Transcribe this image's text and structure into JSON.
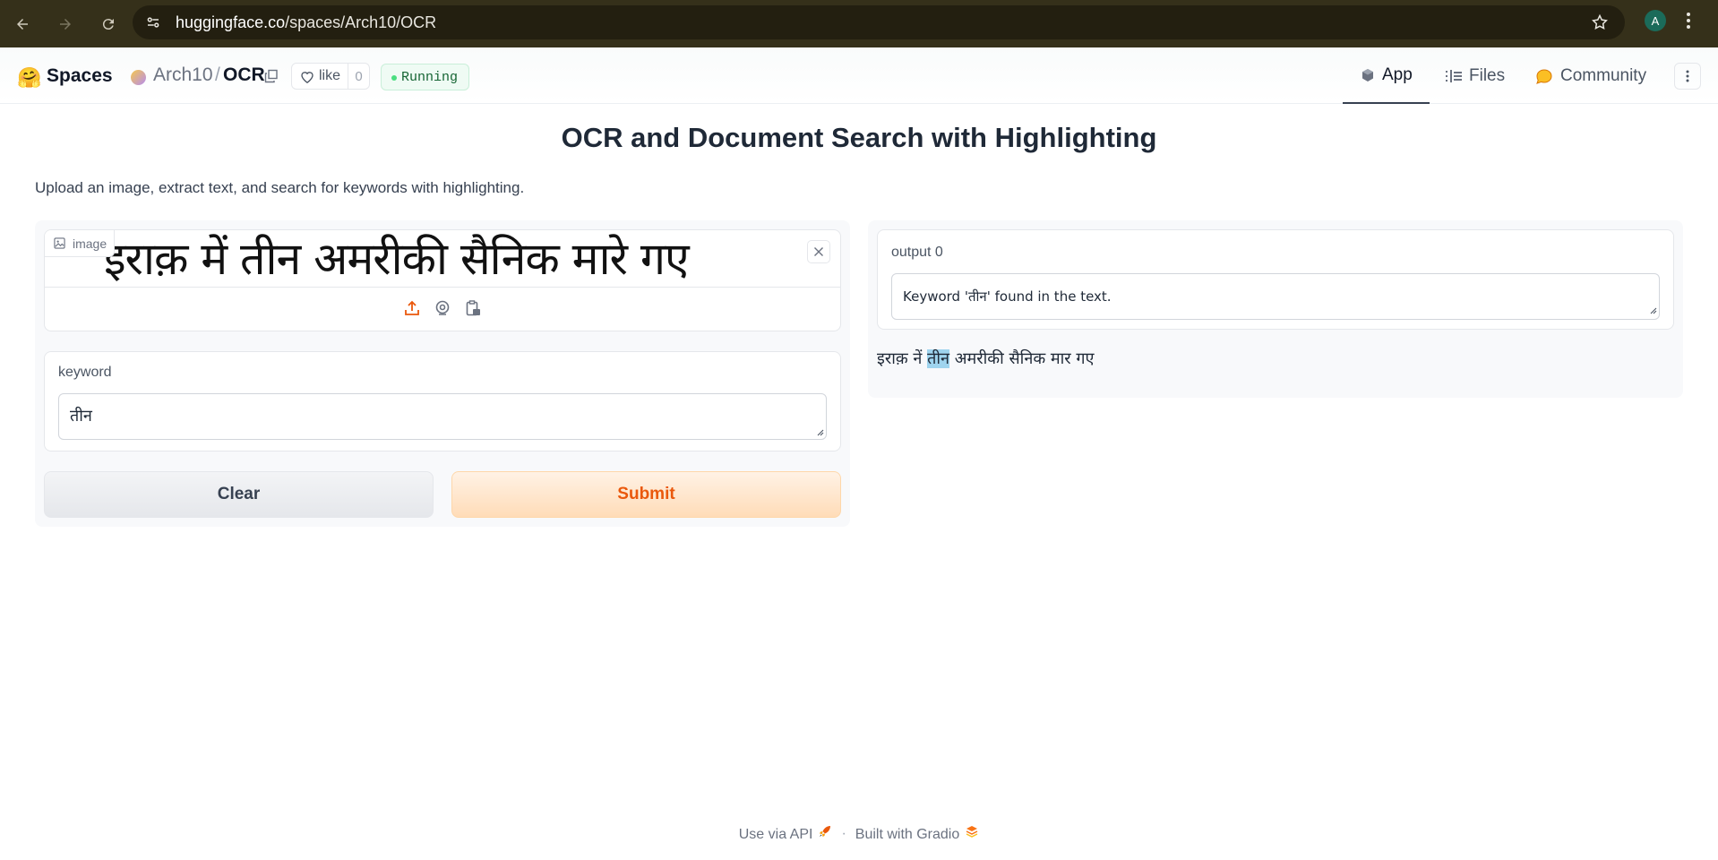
{
  "browser": {
    "url_host": "huggingface.co",
    "url_path": "/spaces/Arch10/OCR",
    "profile_initial": "A"
  },
  "header": {
    "logo_emoji": "🤗",
    "spaces_label": "Spaces",
    "owner": "Arch10",
    "separator": "/",
    "repo": "OCR",
    "like_label": "like",
    "like_count": "0",
    "status": "Running",
    "tabs": [
      {
        "label": "App",
        "active": true
      },
      {
        "label": "Files",
        "active": false
      },
      {
        "label": "Community",
        "active": false
      }
    ]
  },
  "app": {
    "title": "OCR and Document Search with Highlighting",
    "description": "Upload an image, extract text, and search for keywords with highlighting.",
    "image_label": "image",
    "image_text": "इराक़ में तीन अमरीकी सैनिक मारे गए",
    "keyword_label": "keyword",
    "keyword_value": "तीन",
    "clear_label": "Clear",
    "submit_label": "Submit",
    "output_label": "output 0",
    "output_value": "Keyword 'तीन' found in the text.",
    "highlight_before": "इराक़ नें ",
    "highlight_match": "तीन",
    "highlight_after": " अमरीकी सैनिक मार गए"
  },
  "footer": {
    "api_label": "Use via API",
    "separator": "·",
    "built_label": "Built with Gradio"
  },
  "colors": {
    "accent": "#ea580c",
    "highlight": "#9fd4ee",
    "browser_bar": "#35301a"
  }
}
